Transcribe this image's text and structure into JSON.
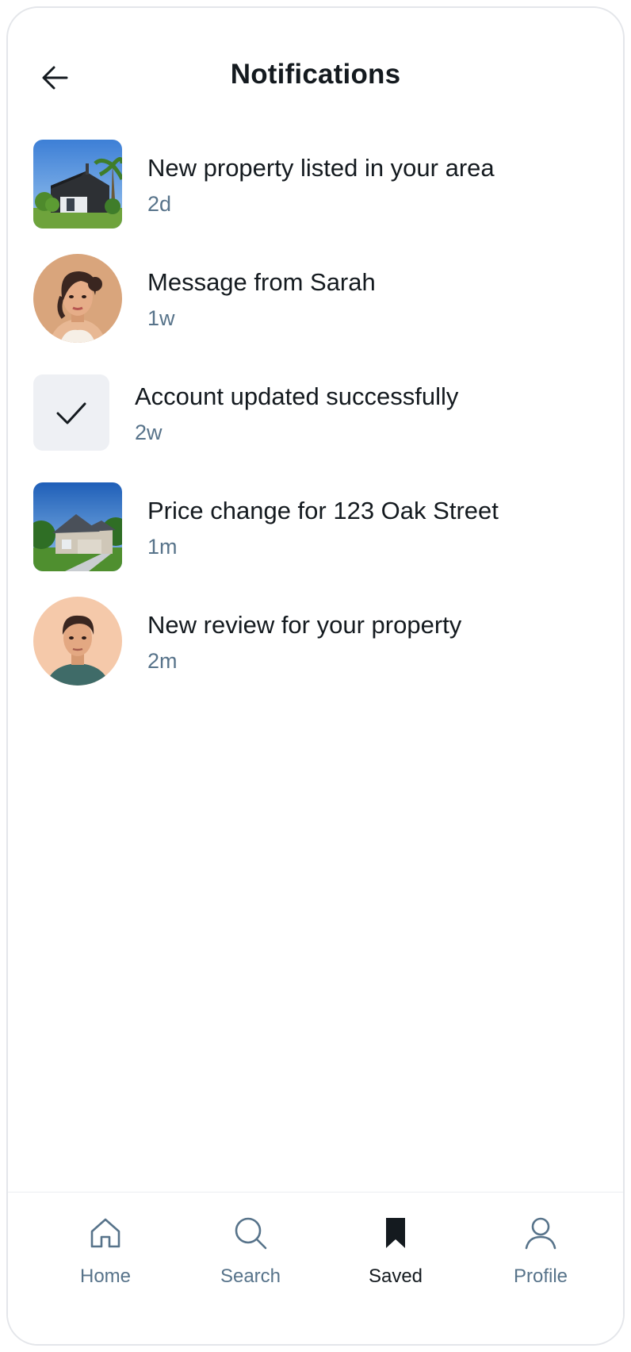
{
  "header": {
    "title": "Notifications",
    "back_icon": "arrow-left-icon"
  },
  "notifications": [
    {
      "title": "New property listed in your area",
      "time": "2d",
      "thumb": "house-photo-modern"
    },
    {
      "title": "Message from Sarah",
      "time": "1w",
      "thumb": "avatar-sarah"
    },
    {
      "title": "Account updated successfully",
      "time": "2w",
      "thumb": "check-icon"
    },
    {
      "title": "Price change for 123 Oak Street",
      "time": "1m",
      "thumb": "house-photo-suburban"
    },
    {
      "title": "New review for your property",
      "time": "2m",
      "thumb": "avatar-man"
    }
  ],
  "nav": {
    "items": [
      {
        "label": "Home",
        "icon": "home-icon",
        "active": false
      },
      {
        "label": "Search",
        "icon": "search-icon",
        "active": false
      },
      {
        "label": "Saved",
        "icon": "bookmark-icon",
        "active": true
      },
      {
        "label": "Profile",
        "icon": "user-icon",
        "active": false
      }
    ]
  },
  "colors": {
    "text_primary": "#141a1f",
    "text_secondary": "#57738a",
    "tile_background": "#eef0f4",
    "divider": "#eceef1"
  }
}
